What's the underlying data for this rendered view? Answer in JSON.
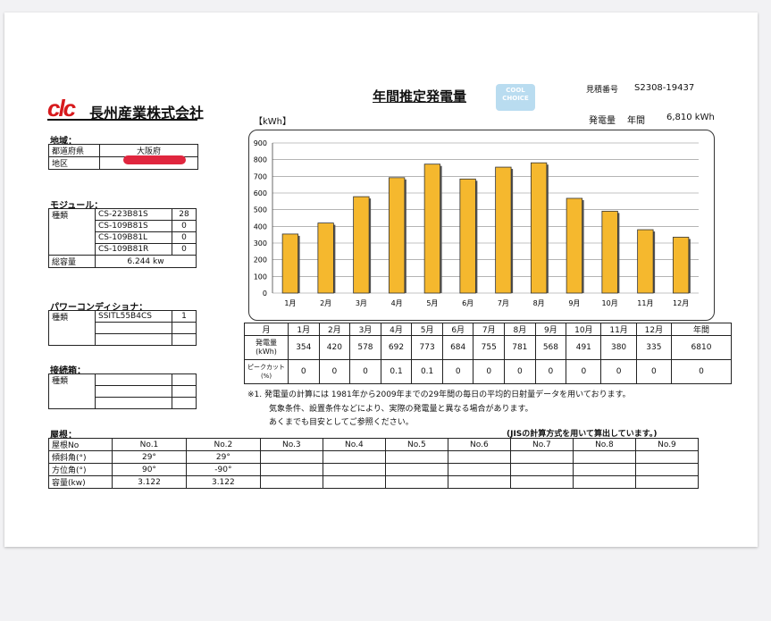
{
  "company": {
    "mark": "clc",
    "name": "長州産業株式会社"
  },
  "header": {
    "title": "年間推定発電量",
    "estimate_label": "見積番号",
    "estimate_no": "S2308-19437",
    "unit": "【kWh】",
    "annual_label": "発電量",
    "annual_period": "年間",
    "annual_value": "6,810 kWh",
    "badge_line1": "COOL",
    "badge_line2": "CHOICE"
  },
  "region": {
    "heading": "地域：",
    "rows": [
      {
        "k": "都道府県",
        "v": "大阪府"
      },
      {
        "k": "地区",
        "v": ""
      }
    ]
  },
  "module": {
    "heading": "モジュール：",
    "type_label": "種類",
    "items": [
      {
        "name": "CS-223B81S",
        "qty": "28"
      },
      {
        "name": "CS-109B81S",
        "qty": "0"
      },
      {
        "name": "CS-109B81L",
        "qty": "0"
      },
      {
        "name": "CS-109B81R",
        "qty": "0"
      }
    ],
    "total_label": "総容量",
    "total_value": "6.244 kw"
  },
  "conditioner": {
    "heading": "パワーコンディショナ：",
    "type_label": "種類",
    "name": "SSITL55B4CS",
    "qty": "1"
  },
  "junction": {
    "heading": "接続箱：",
    "type_label": "種類"
  },
  "chart_data": {
    "type": "bar",
    "categories": [
      "1月",
      "2月",
      "3月",
      "4月",
      "5月",
      "6月",
      "7月",
      "8月",
      "9月",
      "10月",
      "11月",
      "12月"
    ],
    "values": [
      354,
      420,
      578,
      692,
      773,
      684,
      755,
      781,
      568,
      491,
      380,
      335
    ],
    "ylim": [
      0,
      900
    ],
    "yticks": [
      "0",
      "100",
      "200",
      "300",
      "400",
      "500",
      "600",
      "700",
      "800",
      "900"
    ],
    "grid": true,
    "bar_color": "#f5b82e"
  },
  "monthly_table": {
    "month_label": "月",
    "gen_label": [
      "発電量",
      "(kWh)"
    ],
    "peak_label": [
      "ピークカット",
      "(%)"
    ],
    "annual_label": "年間",
    "months": [
      "1月",
      "2月",
      "3月",
      "4月",
      "5月",
      "6月",
      "7月",
      "8月",
      "9月",
      "10月",
      "11月",
      "12月"
    ],
    "gen": [
      "354",
      "420",
      "578",
      "692",
      "773",
      "684",
      "755",
      "781",
      "568",
      "491",
      "380",
      "335"
    ],
    "gen_total": "6810",
    "peak": [
      "0",
      "0",
      "0",
      "0.1",
      "0.1",
      "0",
      "0",
      "0",
      "0",
      "0",
      "0",
      "0"
    ],
    "peak_total": "0"
  },
  "notes": [
    "※1. 発電量の計算には 1981年から2009年までの29年間の毎日の平均的日射量データを用いております。",
    "気象条件、設置条件などにより、実際の発電量と異なる場合があります。",
    "あくまでも目安としてご参照ください。"
  ],
  "roof": {
    "heading": "屋根：",
    "jis_note": "(JISの計算方式を用いて算出しています。)",
    "row_labels": [
      "屋根No",
      "傾斜角(°)",
      "方位角(°)",
      "容量(kw)"
    ],
    "cols": [
      "No.1",
      "No.2",
      "No.3",
      "No.4",
      "No.5",
      "No.6",
      "No.7",
      "No.8",
      "No.9"
    ],
    "tilt": [
      "29°",
      "29°",
      "",
      "",
      "",
      "",
      "",
      "",
      ""
    ],
    "azimuth": [
      "90°",
      "-90°",
      "",
      "",
      "",
      "",
      "",
      "",
      ""
    ],
    "capacity": [
      "3.122",
      "3.122",
      "",
      "",
      "",
      "",
      "",
      "",
      ""
    ]
  }
}
